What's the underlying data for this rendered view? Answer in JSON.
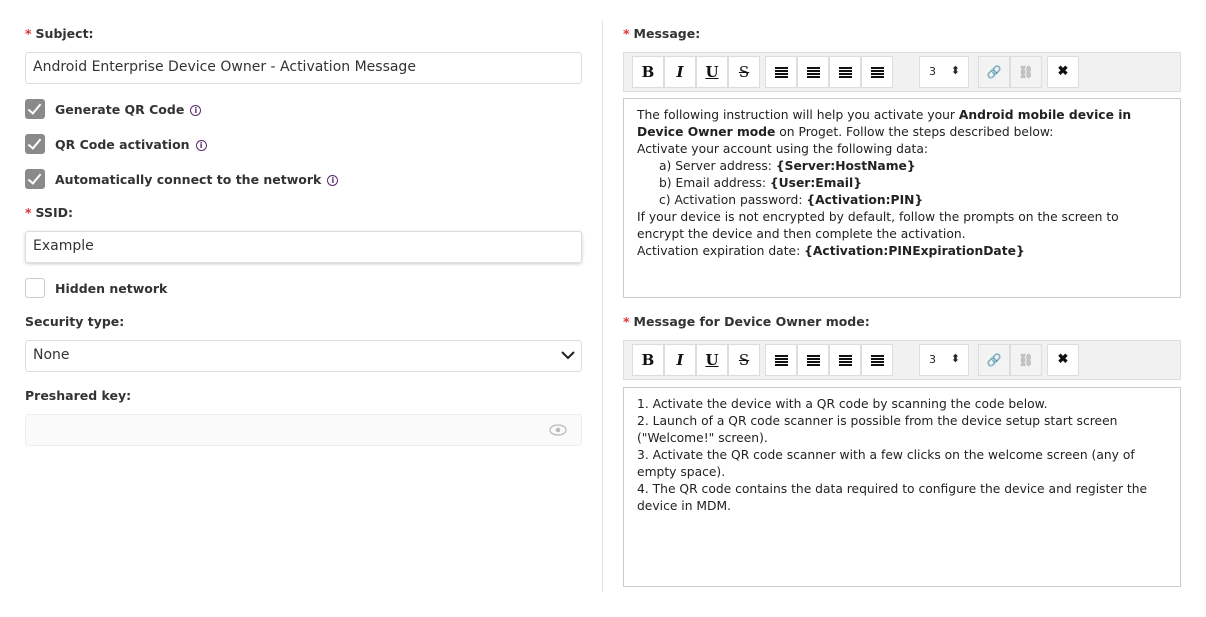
{
  "left": {
    "subject_label": "Subject:",
    "subject_value": "Android Enterprise Device Owner - Activation Message",
    "checkboxes": [
      {
        "label": "Generate QR Code",
        "checked": true
      },
      {
        "label": "QR Code activation",
        "checked": true
      },
      {
        "label": "Automatically connect to the network",
        "checked": true
      }
    ],
    "ssid_label": "SSID:",
    "ssid_value": "Example",
    "hidden_label": "Hidden network",
    "hidden_checked": false,
    "security_label": "Security type:",
    "security_value": "None",
    "psk_label": "Preshared key:",
    "psk_value": ""
  },
  "toolbar": {
    "bold": "B",
    "italic": "I",
    "underline": "U",
    "strike": "S",
    "font_size": "3",
    "remove": "✖"
  },
  "message": {
    "label": "Message:"
  },
  "message2": {
    "label": "Message for Device Owner mode:",
    "lines": [
      "1. Activate the device with a QR code by scanning the code below.",
      "2. Launch of a QR code scanner is possible from the device setup start screen (\"Welcome!\" screen).",
      "3. Activate the QR code scanner with a few clicks on the welcome screen (any of empty space).",
      "4. The QR code contains the data required to configure the device and register the device in MDM."
    ]
  },
  "msg": {
    "p1a": "The following instruction will help you activate your ",
    "p1b": "Android mobile device in Device Owner mode",
    "p1c": " on Proget. Follow the steps described below:",
    "p2": "Activate your account using the following data:",
    "a": "a) Server address: ",
    "av": "{Server:HostName}",
    "b": "b) Email address: ",
    "bv": "{User:Email}",
    "c": "c) Activation password: ",
    "cv": "{Activation:PIN}",
    "p3": "If your device is not encrypted by default, follow the prompts on the screen to encrypt the device and then complete the activation.",
    "p4": "Activation expiration date: ",
    "p4v": "{Activation:PINExpirationDate}"
  }
}
